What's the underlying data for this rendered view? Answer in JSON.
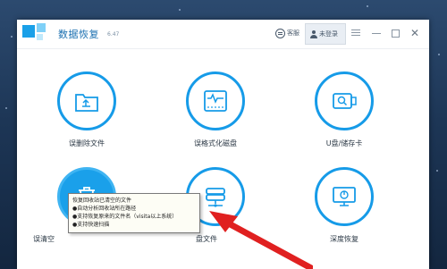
{
  "window": {
    "title": "数据恢复",
    "version": "6.47"
  },
  "toolbar": {
    "feedback_label": "客服",
    "login_label": "未登录"
  },
  "cards": [
    {
      "label": "误删除文件",
      "icon": "folder-recycle-icon"
    },
    {
      "label": "误格式化磁盘",
      "icon": "disk-pulse-icon"
    },
    {
      "label": "U盘/储存卡",
      "icon": "usb-search-icon"
    },
    {
      "label": "误清空",
      "icon": "trash-bin-icon"
    },
    {
      "label": "盘文件",
      "icon": "hard-drive-network-icon"
    },
    {
      "label": "深度恢复",
      "icon": "monitor-deep-scan-icon"
    }
  ],
  "tooltip": {
    "title": "恢复回收站已清空的文件",
    "bullets": [
      "●自动分析回收站所在路径",
      "●支持恢复原来的文件名（visita以上系统）",
      "●支持快速扫描"
    ]
  },
  "colors": {
    "accent": "#169be8",
    "annotation_arrow": "#e02020"
  }
}
